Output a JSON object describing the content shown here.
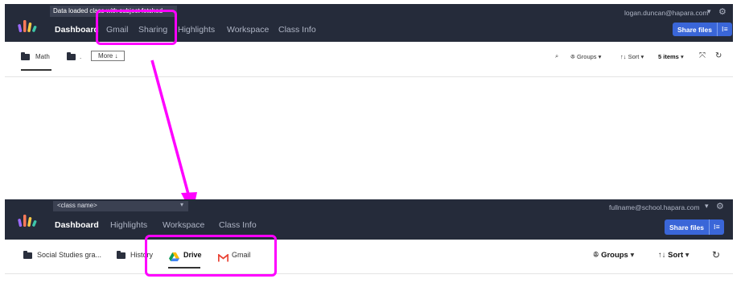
{
  "top": {
    "toast": "Data loaded class with subject fetched",
    "nav": [
      "Dashboard",
      "Gmail",
      "Sharing",
      "Highlights",
      "Workspace",
      "Class Info"
    ],
    "email": "logan.duncan@hapara.com",
    "share_label": "Share files",
    "tabs": [
      "Math",
      "."
    ],
    "more_label": "More",
    "more_arrow": "↓",
    "groups": "Groups",
    "sort": "Sort",
    "items": "5 items"
  },
  "bottom": {
    "class_select": "<class name>",
    "nav": [
      "Dashboard",
      "Highlights",
      "Workspace",
      "Class Info"
    ],
    "email": "fullname@school.hapara.com",
    "share_label": "Share files",
    "tabs": [
      "Social Studies gra...",
      "History",
      "Drive",
      "Gmail"
    ],
    "groups": "Groups",
    "sort": "Sort"
  },
  "colors": {
    "header_bg": "#252b3a",
    "accent": "#3a66d8",
    "annotation": "#ff00ff"
  },
  "icons": [
    "hapara-logo-icon",
    "gear-icon",
    "list-icon",
    "folder-icon",
    "search-icon",
    "groups-icon",
    "sort-icon",
    "expand-icon",
    "refresh-icon",
    "chevron-down-icon",
    "drive-icon",
    "gmail-icon"
  ]
}
